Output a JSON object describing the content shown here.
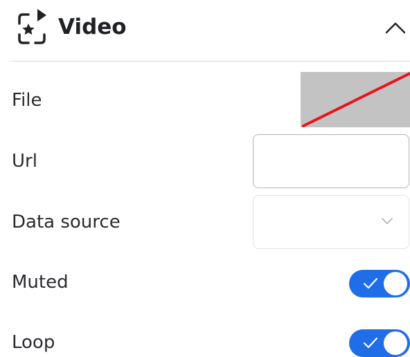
{
  "panel": {
    "title": "Video",
    "icon": "video-effects-icon",
    "collapse_icon": "chevron-up-icon",
    "expanded": true
  },
  "fields": {
    "file": {
      "label": "File",
      "preview_icon": "empty-file-placeholder-icon",
      "placeholder_color": "#c3c3c3",
      "slash_color": "#e8141b"
    },
    "url": {
      "label": "Url",
      "value": "",
      "placeholder": ""
    },
    "data_source": {
      "label": "Data source",
      "selected": "",
      "chevron_icon": "chevron-down-icon"
    },
    "muted": {
      "label": "Muted",
      "checked": true,
      "check_icon": "checkmark-icon"
    },
    "loop": {
      "label": "Loop",
      "checked": true,
      "check_icon": "checkmark-icon"
    }
  },
  "colors": {
    "accent": "#1f6ee8",
    "text": "#2a2b30",
    "divider": "#d9d9d9",
    "input_border": "#b5b5b5"
  }
}
